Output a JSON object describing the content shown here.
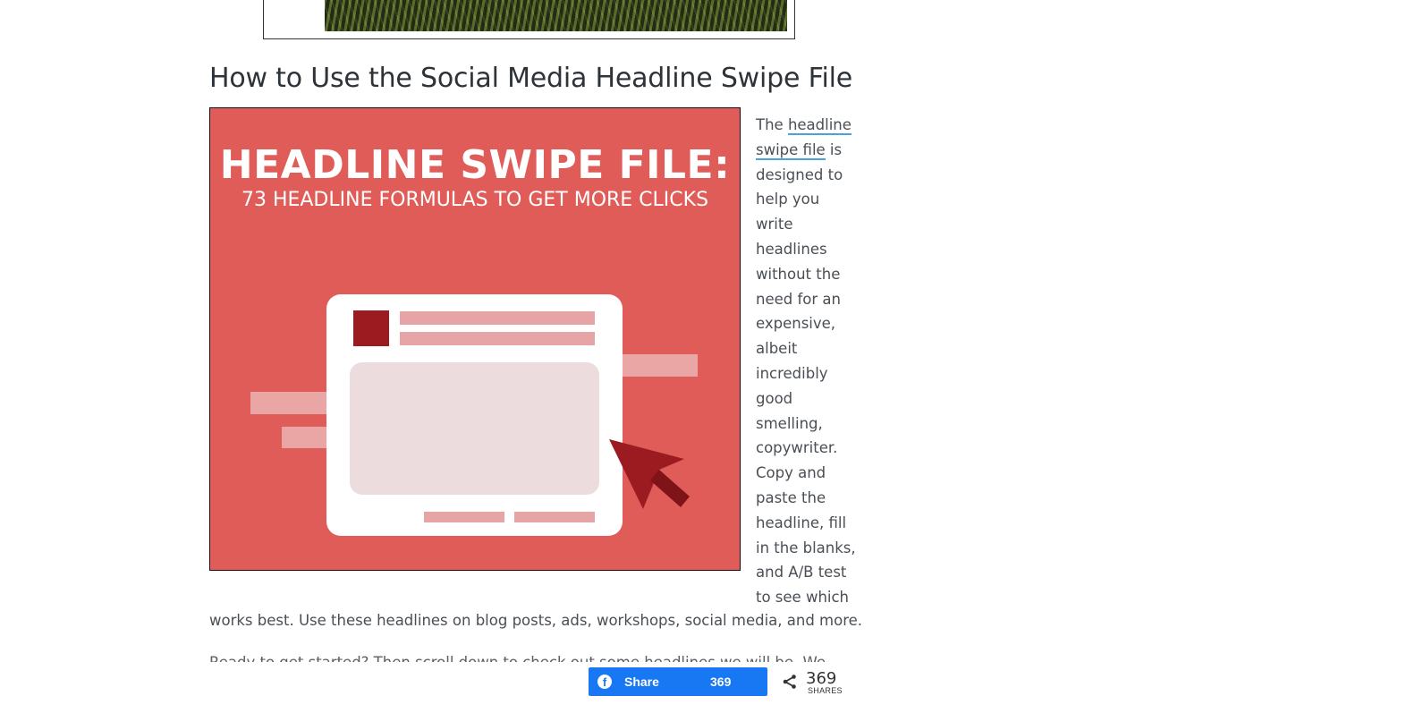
{
  "article": {
    "title": "How to Use the Social Media Headline Swipe File",
    "feature_image": {
      "heading": "HEADLINE SWIPE FILE:",
      "subheading": "73 HEADLINE FORMULAS TO GET MORE CLICKS"
    },
    "paragraph_intro": "The ",
    "paragraph_link": "headline swipe file",
    "paragraph_side": " is designed to help you write headlines without the need for an expensive, albeit incredibly good smelling, copywriter. Copy and paste the headline, fill in the blanks, and A/B test to see which",
    "paragraph_continued": "works best. Use these headlines on blog posts, ads, workshops, social media, and more.",
    "paragraph_next_partial": "Ready to get started? Then scroll down to check out some headlines we will be. We"
  },
  "share_bar": {
    "facebook_label": "Share",
    "facebook_count": "369",
    "total_count": "369",
    "total_label": "SHARES"
  },
  "colors": {
    "image_background": "#e05c58",
    "link_underline": "#4aa2d8",
    "facebook_blue": "#1877f2"
  }
}
